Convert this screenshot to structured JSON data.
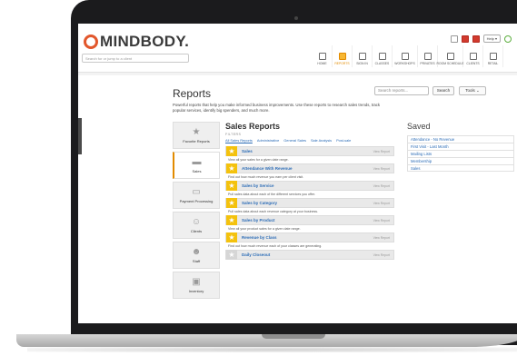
{
  "app": {
    "logo_text": "MINDBODY.",
    "search_client_placeholder": "Search for or jump to a client",
    "help_label": "Help ▾"
  },
  "nav": {
    "tabs": [
      {
        "label": "HOME",
        "icon": "home-icon"
      },
      {
        "label": "REPORTS",
        "icon": "reports-icon",
        "active": true
      },
      {
        "label": "SIGN IN",
        "icon": "sign-in-icon"
      },
      {
        "label": "CLASSES",
        "icon": "classes-icon"
      },
      {
        "label": "WORKSHOPS",
        "icon": "workshops-icon"
      },
      {
        "label": "PRIVATES",
        "icon": "privates-icon"
      },
      {
        "label": "ROOM SCHEDULE",
        "icon": "room-schedule-icon"
      },
      {
        "label": "CLIENTS",
        "icon": "clients-icon"
      },
      {
        "label": "RETAIL",
        "icon": "retail-icon"
      }
    ],
    "active_color": "#e28b00"
  },
  "reports": {
    "title": "Reports",
    "subtitle": "Powerful reports that help you make informed business improvements. Use these reports to research sales trends, track popular services, identify big spenders, and much more.",
    "search_placeholder": "Search reports...",
    "search_button": "Search",
    "tools_button": "Tools ⌄"
  },
  "categories": [
    {
      "label": "Favorite Reports",
      "icon": "star-icon"
    },
    {
      "label": "Sales",
      "icon": "register-icon",
      "active": true
    },
    {
      "label": "Payment Processing",
      "icon": "card-icon"
    },
    {
      "label": "Clients",
      "icon": "clients-icon"
    },
    {
      "label": "Staff",
      "icon": "staff-icon"
    },
    {
      "label": "Inventory",
      "icon": "inventory-icon"
    }
  ],
  "panel": {
    "title": "Sales Reports",
    "filters_label": "FILTERS",
    "filters": [
      "All Sales Reports",
      "Administrative",
      "General Sales",
      "Sale Analysis",
      "Post-sale"
    ],
    "view_label": "View Report",
    "items": [
      {
        "name": "Sales",
        "desc": "View all your sales for a given date range.",
        "starred": true
      },
      {
        "name": "Attendance With Revenue",
        "desc": "Find out how much revenue you earn per client visit.",
        "starred": true
      },
      {
        "name": "Sales by Service",
        "desc": "Pull sales data about each of the different services you offer.",
        "starred": true
      },
      {
        "name": "Sales by Category",
        "desc": "Pull sales data about each revenue category at your business.",
        "starred": true
      },
      {
        "name": "Sales by Product",
        "desc": "View all your product sales for a given date range.",
        "starred": true
      },
      {
        "name": "Revenue by Class",
        "desc": "Find out how much revenue each of your classes are generating.",
        "starred": true
      },
      {
        "name": "Daily Closeout",
        "desc": "",
        "starred": false
      }
    ]
  },
  "saved": {
    "title": "Saved",
    "items": [
      "Attendance - No Revenue",
      "First Visit - Last Month",
      "Mailing Lists",
      "Membership",
      "Sales"
    ]
  }
}
